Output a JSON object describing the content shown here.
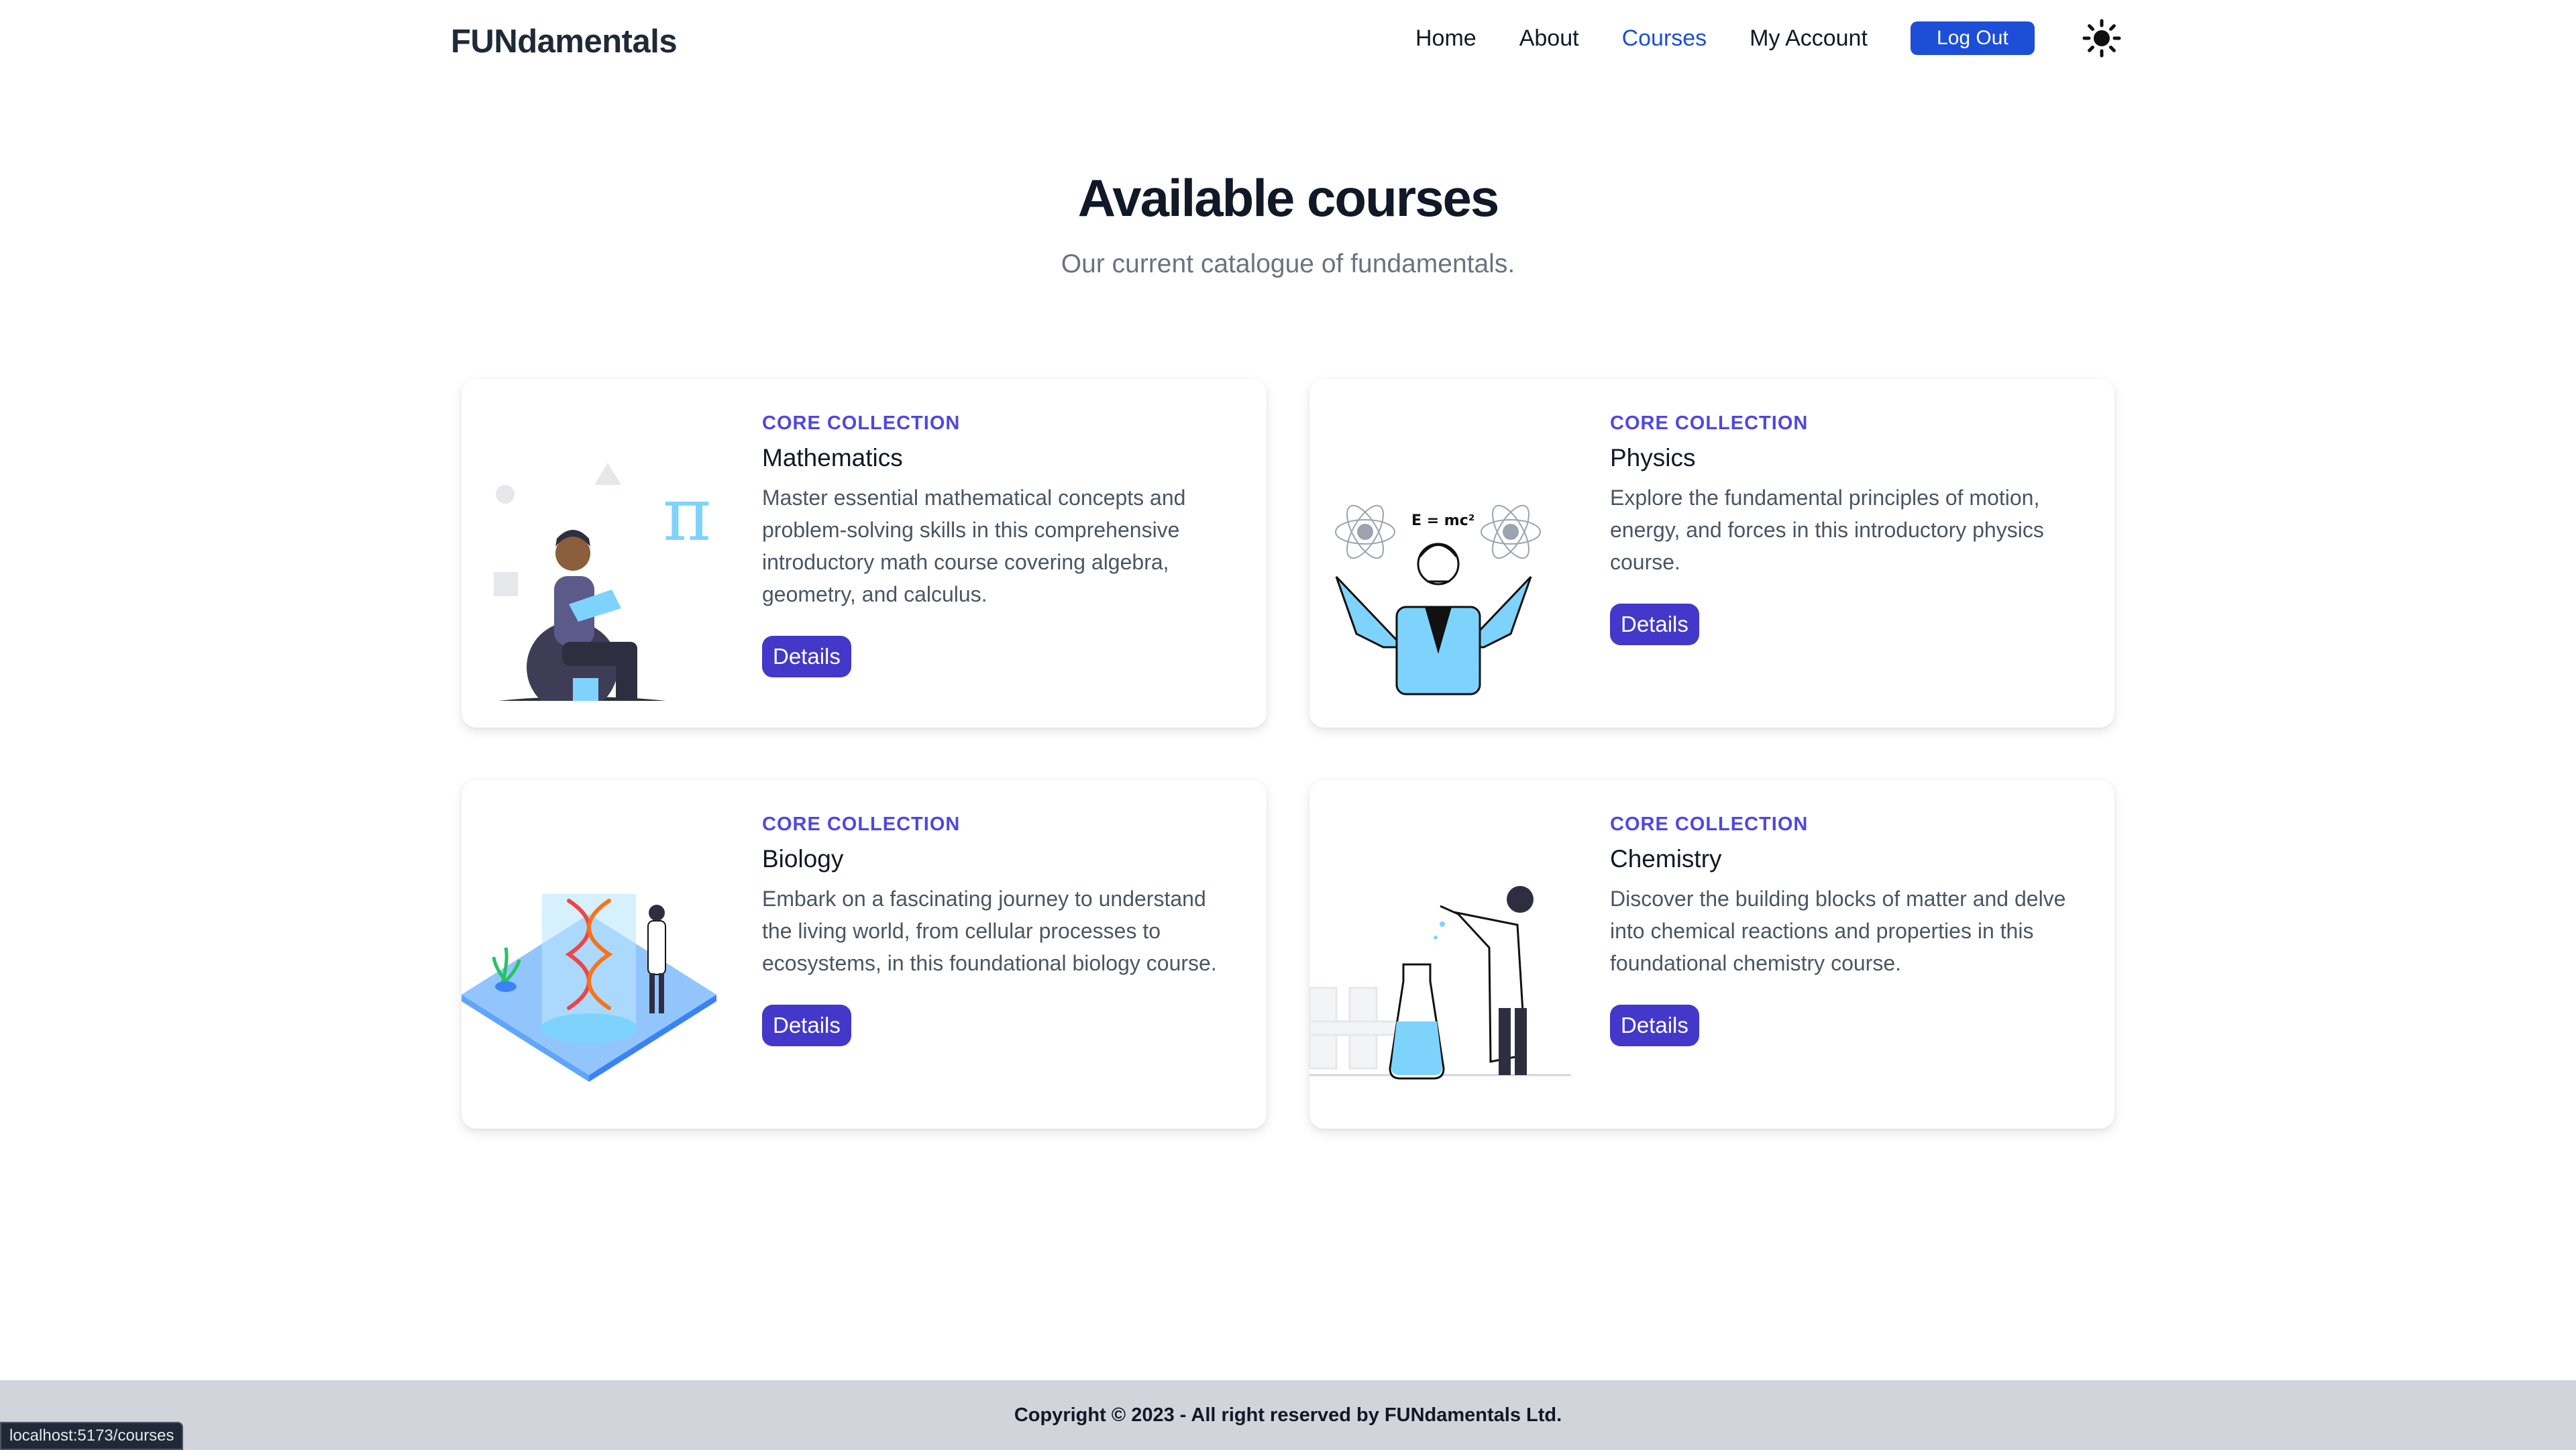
{
  "header": {
    "brand": "FUNdamentals",
    "nav": [
      {
        "label": "Home"
      },
      {
        "label": "About"
      },
      {
        "label": "Courses"
      },
      {
        "label": "My Account"
      }
    ],
    "active_nav": "Courses",
    "logout_label": "Log Out",
    "theme_icon": "sun-icon"
  },
  "hero": {
    "title": "Available courses",
    "subtitle": "Our current catalogue of fundamentals."
  },
  "courses": [
    {
      "collection": "CORE COLLECTION",
      "title": "Mathematics",
      "description": "Master essential mathematical concepts and problem-solving skills in this comprehensive introductory math course covering algebra, geometry, and calculus.",
      "button": "Details",
      "illustration": "math-illustration"
    },
    {
      "collection": "CORE COLLECTION",
      "title": "Physics",
      "description": "Explore the fundamental principles of motion, energy, and forces in this introductory physics course.",
      "button": "Details",
      "illustration": "physics-illustration",
      "illustration_text": "E = mc²"
    },
    {
      "collection": "CORE COLLECTION",
      "title": "Biology",
      "description": "Embark on a fascinating journey to understand the living world, from cellular processes to ecosystems, in this foundational biology course.",
      "button": "Details",
      "illustration": "biology-illustration"
    },
    {
      "collection": "CORE COLLECTION",
      "title": "Chemistry",
      "description": "Discover the building blocks of matter and delve into chemical reactions and properties in this foundational chemistry course.",
      "button": "Details",
      "illustration": "chemistry-illustration"
    }
  ],
  "footer": {
    "copyright": "Copyright © 2023 - All right reserved by FUNdamentals Ltd."
  },
  "status_bar": {
    "url": "localhost:5173/courses"
  },
  "colors": {
    "accent": "#1d4ed8",
    "button": "#4338ca",
    "collection_label": "#4f46e5",
    "illustration_blue": "#7dd3fc",
    "footer_bg": "#d1d5db"
  }
}
